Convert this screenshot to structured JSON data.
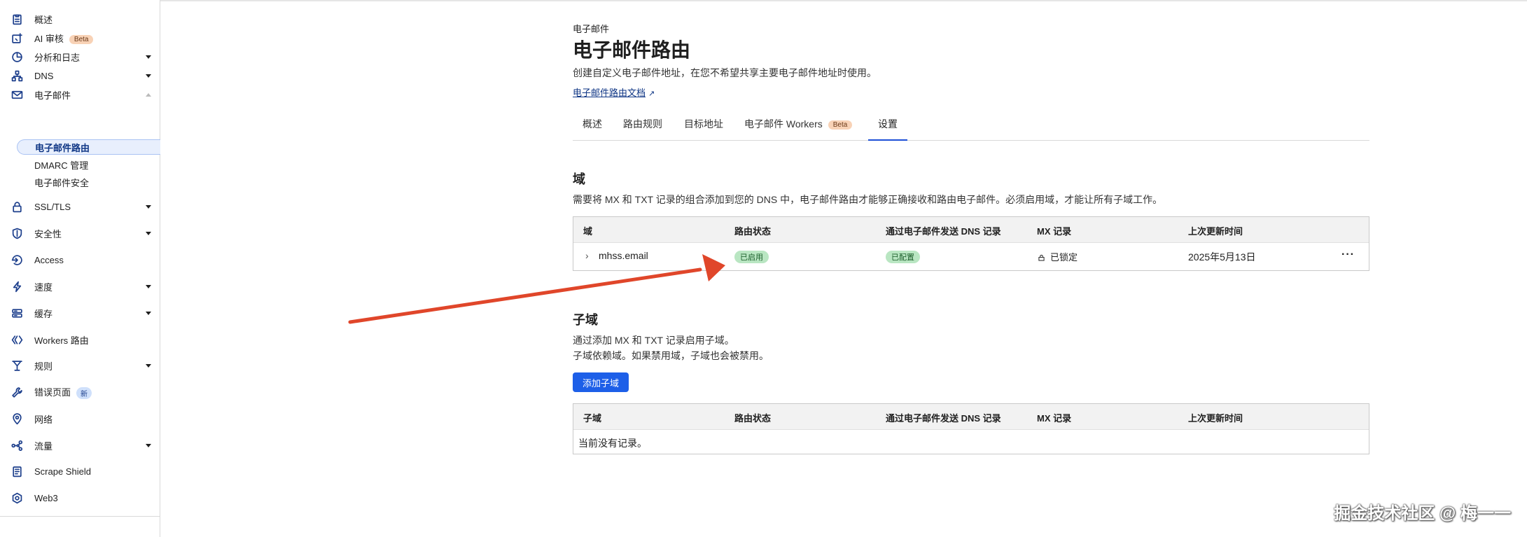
{
  "sidebar": {
    "items": [
      {
        "label": "概述",
        "icon": "clipboard-icon"
      },
      {
        "label": "AI 审核",
        "icon": "ai-audit-icon",
        "badge": "Beta"
      },
      {
        "label": "分析和日志",
        "icon": "analytics-icon"
      },
      {
        "label": "DNS",
        "icon": "dns-icon"
      },
      {
        "label": "电子邮件",
        "icon": "mail-icon"
      },
      {
        "label": "SSL/TLS",
        "icon": "lock-icon"
      },
      {
        "label": "安全性",
        "icon": "shield-icon"
      },
      {
        "label": "Access",
        "icon": "access-icon"
      },
      {
        "label": "速度",
        "icon": "lightning-icon"
      },
      {
        "label": "缓存",
        "icon": "cache-icon"
      },
      {
        "label": "Workers 路由",
        "icon": "workers-icon"
      },
      {
        "label": "规则",
        "icon": "rules-icon"
      },
      {
        "label": "错误页面",
        "icon": "wrench-icon",
        "badge": "新"
      },
      {
        "label": "网络",
        "icon": "location-pin-icon"
      },
      {
        "label": "流量",
        "icon": "traffic-icon"
      },
      {
        "label": "Scrape Shield",
        "icon": "document-icon"
      },
      {
        "label": "Web3",
        "icon": "web3-icon"
      }
    ],
    "email_sub": [
      "电子邮件路由",
      "DMARC 管理",
      "电子邮件安全"
    ]
  },
  "header": {
    "crumb": "电子邮件",
    "title": "电子邮件路由",
    "description": "创建自定义电子邮件地址，在您不希望共享主要电子邮件地址时使用。",
    "doc_link": "电子邮件路由文档"
  },
  "tabs": [
    {
      "label": "概述"
    },
    {
      "label": "路由规则"
    },
    {
      "label": "目标地址"
    },
    {
      "label": "电子邮件 Workers",
      "badge": "Beta"
    },
    {
      "label": "设置"
    }
  ],
  "domain_section": {
    "title": "域",
    "text": "需要将 MX 和 TXT 记录的组合添加到您的 DNS 中，电子邮件路由才能够正确接收和路由电子邮件。必须启用域，才能让所有子域工作。",
    "headers": [
      "域",
      "路由状态",
      "通过电子邮件发送 DNS 记录",
      "MX 记录",
      "上次更新时间"
    ],
    "row": {
      "domain": "mhss.email",
      "route_status": "已启用",
      "dns_status": "已配置",
      "mx": "已锁定",
      "updated": "2025年5月13日",
      "more": "···"
    }
  },
  "subdomain_section": {
    "title": "子域",
    "text1": "通过添加 MX 和 TXT 记录启用子域。",
    "text2": "子域依赖域。如果禁用域，子域也会被禁用。",
    "add_button": "添加子域",
    "headers": [
      "子域",
      "路由状态",
      "通过电子邮件发送 DNS 记录",
      "MX 记录",
      "上次更新时间"
    ],
    "empty": "当前没有记录。"
  },
  "watermark": "掘金技术社区 @ 梅一一",
  "colors": {
    "accent": "#1d5fe8",
    "arrow": "#e0462a",
    "nav_icon": "#1d3f8c"
  }
}
